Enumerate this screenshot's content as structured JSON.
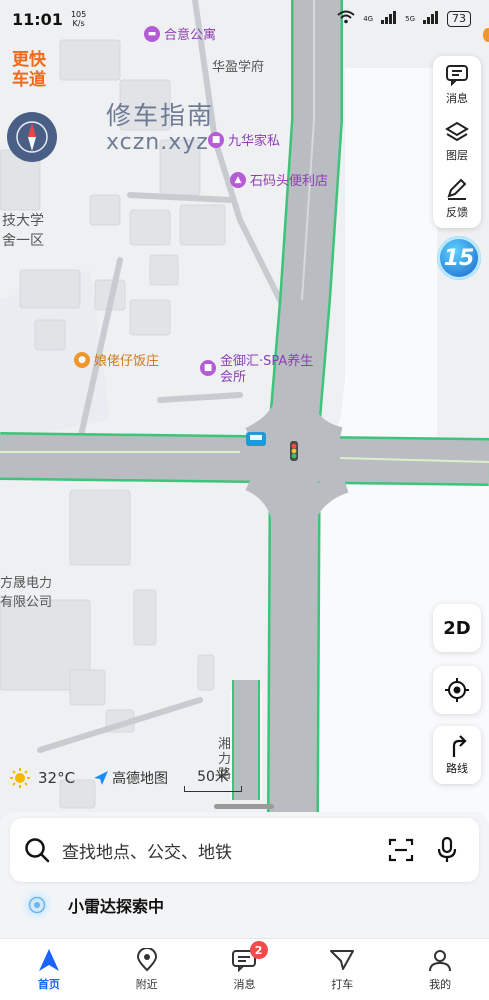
{
  "status_bar": {
    "time": "11:01",
    "net_speed_value": "105",
    "net_speed_unit": "K/s",
    "net_4g": "4G",
    "net_5g": "5G",
    "battery": "73"
  },
  "brand": {
    "line1": "更快",
    "line2": "车道"
  },
  "watermark": {
    "title": "修车指南",
    "domain": "xczn.xyz"
  },
  "map_labels": {
    "apartment": "合意公寓",
    "school": "华盈学府",
    "family": "九华家私",
    "store": "石码头便利店",
    "university_line1": "技大学",
    "university_line2": "舍一区",
    "restaurant": "娘佬仔饭庄",
    "spa_line1": "金御汇·SPA养生",
    "spa_line2": "会所",
    "power_line1": "方晟电力",
    "power_line2": "有限公司",
    "road": "湘力路"
  },
  "tools": {
    "message": "消息",
    "layers": "图层",
    "feedback": "反馈"
  },
  "badge": "15",
  "view_mode": "2D",
  "route_label": "路线",
  "weather": {
    "temp": "32°C",
    "provider": "高德地图"
  },
  "scale_label": "50米",
  "search": {
    "placeholder": "查找地点、公交、地铁"
  },
  "radar": {
    "label": "小雷达探索中"
  },
  "tabs": [
    {
      "label": "首页"
    },
    {
      "label": "附近"
    },
    {
      "label": "消息",
      "badge": "2"
    },
    {
      "label": "打车"
    },
    {
      "label": "我的"
    }
  ],
  "colors": {
    "road": "#b9bcc1",
    "road_edge": "#3cc47a",
    "active_tab": "#1a63ff",
    "poi_purple": "#b55bd6",
    "poi_orange": "#f0962a",
    "brand_orange": "#ef6a1a"
  }
}
